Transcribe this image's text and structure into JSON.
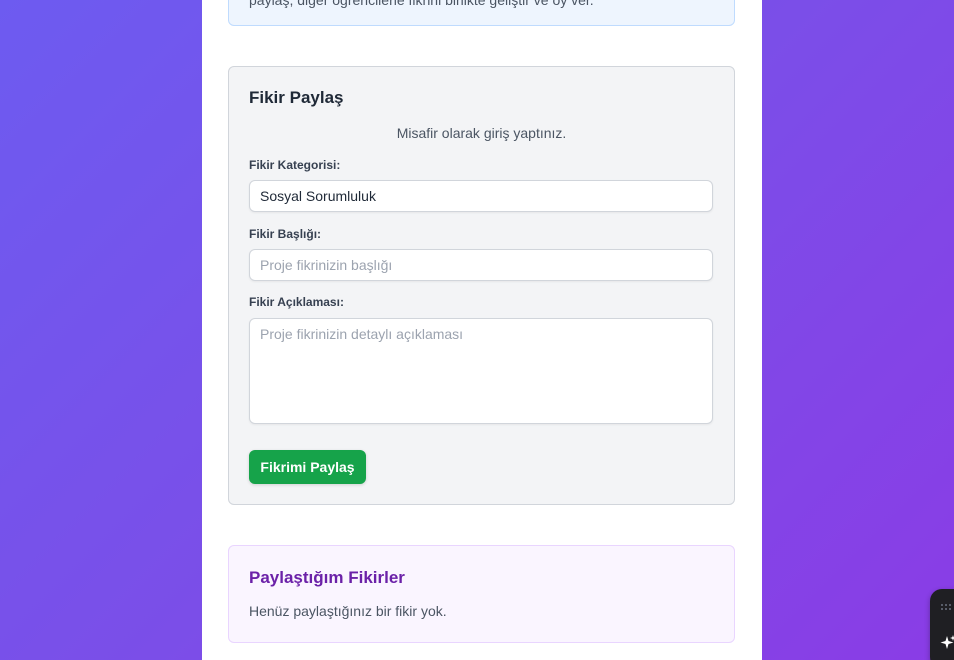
{
  "info_box": {
    "text": "paylaş, diğer öğrencilerle fikrini birlikte geliştir ve oy ver."
  },
  "share_form": {
    "title": "Fikir Paylaş",
    "login_status": "Misafir olarak giriş yaptınız.",
    "category_label": "Fikir Kategorisi:",
    "category_value": "Sosyal Sorumluluk",
    "title_label": "Fikir Başlığı:",
    "title_placeholder": "Proje fikrinizin başlığı",
    "description_label": "Fikir Açıklaması:",
    "description_placeholder": "Proje fikrinizin detaylı açıklaması",
    "submit_label": "Fikrimi Paylaş"
  },
  "my_ideas": {
    "title": "Paylaştığım Fikirler",
    "empty_text": "Henüz paylaştığınız bir fikir yok."
  },
  "floating_widget": {
    "icons": [
      "grip-icon",
      "sparkle-icon"
    ]
  },
  "colors": {
    "background_gradient_start": "#6d5bf0",
    "background_gradient_end": "#8a3ce6",
    "submit_button": "#16a34a",
    "ideas_title": "#6b21a8",
    "info_box_bg": "#eef5fe",
    "ideas_card_bg": "#faf5ff"
  }
}
